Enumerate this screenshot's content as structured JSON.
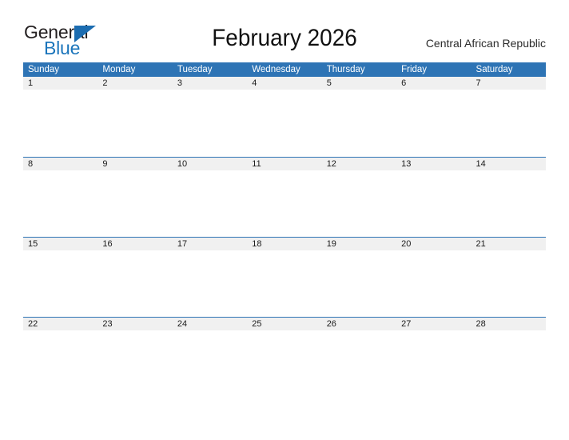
{
  "brand": {
    "name_part1": "General",
    "name_part2": "Blue",
    "colors": {
      "dark": "#231f20",
      "blue": "#1b75bb",
      "triangle": "#1b6cb0"
    }
  },
  "header": {
    "title": "February 2026",
    "country": "Central African Republic"
  },
  "calendar": {
    "accent_color": "#2e74b5",
    "date_band_color": "#f0f0f0",
    "weekdays": [
      "Sunday",
      "Monday",
      "Tuesday",
      "Wednesday",
      "Thursday",
      "Friday",
      "Saturday"
    ],
    "weeks": [
      {
        "days": [
          "1",
          "2",
          "3",
          "4",
          "5",
          "6",
          "7"
        ]
      },
      {
        "days": [
          "8",
          "9",
          "10",
          "11",
          "12",
          "13",
          "14"
        ]
      },
      {
        "days": [
          "15",
          "16",
          "17",
          "18",
          "19",
          "20",
          "21"
        ]
      },
      {
        "days": [
          "22",
          "23",
          "24",
          "25",
          "26",
          "27",
          "28"
        ]
      }
    ]
  }
}
